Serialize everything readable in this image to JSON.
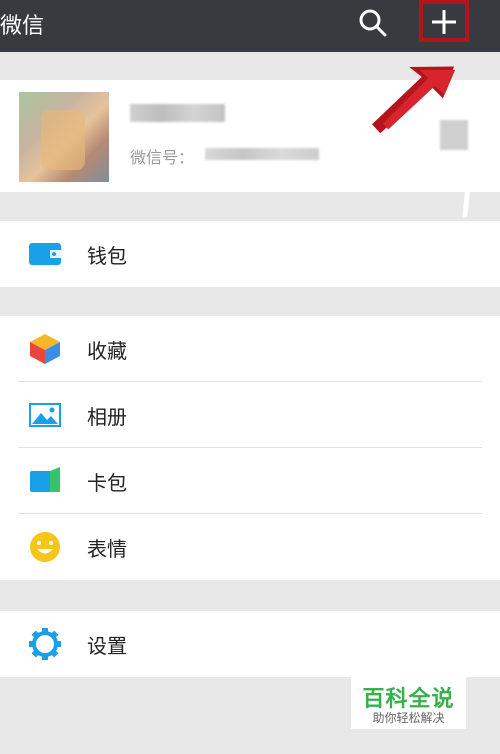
{
  "header": {
    "title": "微信",
    "search_icon": "search-icon",
    "add_icon": "plus-icon"
  },
  "profile": {
    "wechat_id_label": "微信号："
  },
  "menu": {
    "wallet": {
      "label": "钱包",
      "icon": "wallet-icon"
    },
    "favorites": {
      "label": "收藏",
      "icon": "cube-icon"
    },
    "album": {
      "label": "相册",
      "icon": "image-icon"
    },
    "card_pack": {
      "label": "卡包",
      "icon": "card-icon"
    },
    "stickers": {
      "label": "表情",
      "icon": "smiley-icon"
    },
    "settings": {
      "label": "设置",
      "icon": "gear-icon"
    }
  },
  "watermark": {
    "title": "百科全说",
    "subtitle": "助你轻松解决"
  },
  "colors": {
    "header_bg": "#393a3f",
    "accent_blue": "#1aa0e6",
    "highlight_red": "#b4141c",
    "watermark_green": "#36b24a"
  }
}
